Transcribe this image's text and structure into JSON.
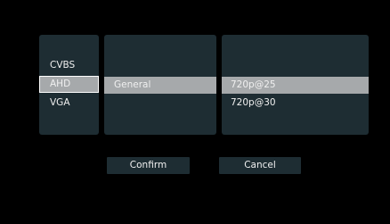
{
  "signal_list": {
    "items": [
      {
        "label": "CVBS"
      },
      {
        "label": "AHD"
      },
      {
        "label": "VGA"
      }
    ],
    "selected": "AHD"
  },
  "mode_list": {
    "items": [
      {
        "label": "General"
      }
    ],
    "selected": "General"
  },
  "resolution_list": {
    "items": [
      {
        "label": "720p@25"
      },
      {
        "label": "720p@30"
      }
    ],
    "selected": "720p@25"
  },
  "buttons": {
    "confirm_label": "Confirm",
    "cancel_label": "Cancel"
  },
  "colors": {
    "background": "#000000",
    "panel": "#1e2d33",
    "highlight": "#a6a9ab",
    "text": "#f0f0f0"
  }
}
